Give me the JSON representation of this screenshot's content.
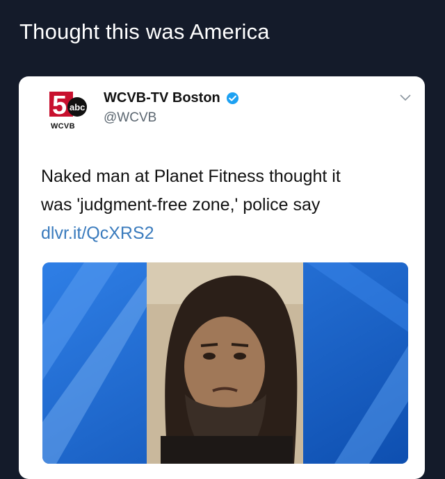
{
  "caption": "Thought this was America",
  "tweet": {
    "display_name": "WCVB-TV Boston",
    "handle": "@WCVB",
    "logo_text": "WCVB",
    "text_line_1": "Naked man at Planet Fitness thought it",
    "text_line_2": "was 'judgment-free zone,' police say",
    "link": "dlvr.it/QcXRS2"
  },
  "colors": {
    "background": "#141b2a",
    "card": "#ffffff",
    "link": "#3a7bbd",
    "verified": "#1da1f2",
    "media_blue": "#1a6cd8"
  },
  "icons": [
    "wcvb-abc-logo-icon",
    "verified-badge-icon",
    "chevron-down-icon"
  ]
}
